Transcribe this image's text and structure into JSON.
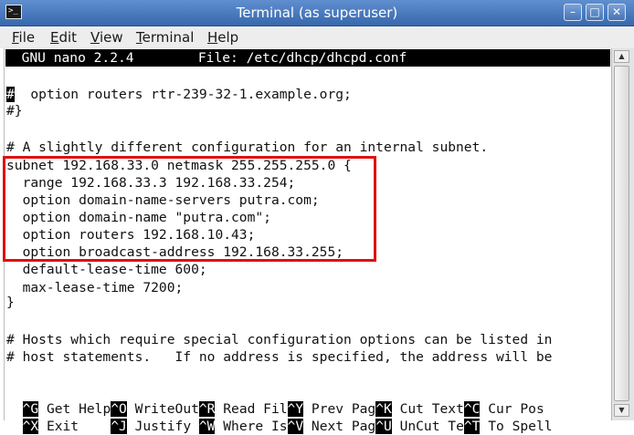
{
  "window": {
    "title": "Terminal (as superuser)",
    "app_icon": "terminal-icon",
    "controls": [
      "minimize-icon",
      "maximize-icon",
      "close-icon"
    ]
  },
  "menu": [
    {
      "mnemonic": "F",
      "rest": "ile"
    },
    {
      "mnemonic": "E",
      "rest": "dit"
    },
    {
      "mnemonic": "V",
      "rest": "iew"
    },
    {
      "mnemonic": "T",
      "rest": "erminal"
    },
    {
      "mnemonic": "H",
      "rest": "elp"
    }
  ],
  "nano": {
    "header": "  GNU nano 2.2.4        File: /etc/dhcp/dhcpd.conf",
    "lines": [
      {
        "cursor": "#",
        "text": "  option routers rtr-239-32-1.example.org;"
      },
      {
        "cursor": "",
        "text": "#}"
      },
      {
        "cursor": "",
        "text": ""
      },
      {
        "cursor": "",
        "text": "# A slightly different configuration for an internal subnet."
      },
      {
        "cursor": "",
        "text": "subnet 192.168.33.0 netmask 255.255.255.0 {"
      },
      {
        "cursor": "",
        "text": "  range 192.168.33.3 192.168.33.254;"
      },
      {
        "cursor": "",
        "text": "  option domain-name-servers putra.com;"
      },
      {
        "cursor": "",
        "text": "  option domain-name \"putra.com\";"
      },
      {
        "cursor": "",
        "text": "  option routers 192.168.10.43;"
      },
      {
        "cursor": "",
        "text": "  option broadcast-address 192.168.33.255;"
      },
      {
        "cursor": "",
        "text": "  default-lease-time 600;"
      },
      {
        "cursor": "",
        "text": "  max-lease-time 7200;"
      },
      {
        "cursor": "",
        "text": "}"
      },
      {
        "cursor": "",
        "text": ""
      },
      {
        "cursor": "",
        "text": "# Hosts which require special configuration options can be listed in"
      },
      {
        "cursor": "",
        "text": "# host statements.   If no address is specified, the address will be"
      }
    ],
    "shortcuts_row1": [
      {
        "key": "^G",
        "label": " Get Help"
      },
      {
        "key": "^O",
        "label": " WriteOut"
      },
      {
        "key": "^R",
        "label": " Read Fil"
      },
      {
        "key": "^Y",
        "label": " Prev Pag"
      },
      {
        "key": "^K",
        "label": " Cut Text"
      },
      {
        "key": "^C",
        "label": " Cur Pos"
      }
    ],
    "shortcuts_row2": [
      {
        "key": "^X",
        "label": " Exit    "
      },
      {
        "key": "^J",
        "label": " Justify "
      },
      {
        "key": "^W",
        "label": " Where Is"
      },
      {
        "key": "^V",
        "label": " Next Pag"
      },
      {
        "key": "^U",
        "label": " UnCut Te"
      },
      {
        "key": "^T",
        "label": " To Spell"
      }
    ]
  },
  "colors": {
    "highlight_box": "#e01010",
    "titlebar": "#4a7cc0"
  }
}
